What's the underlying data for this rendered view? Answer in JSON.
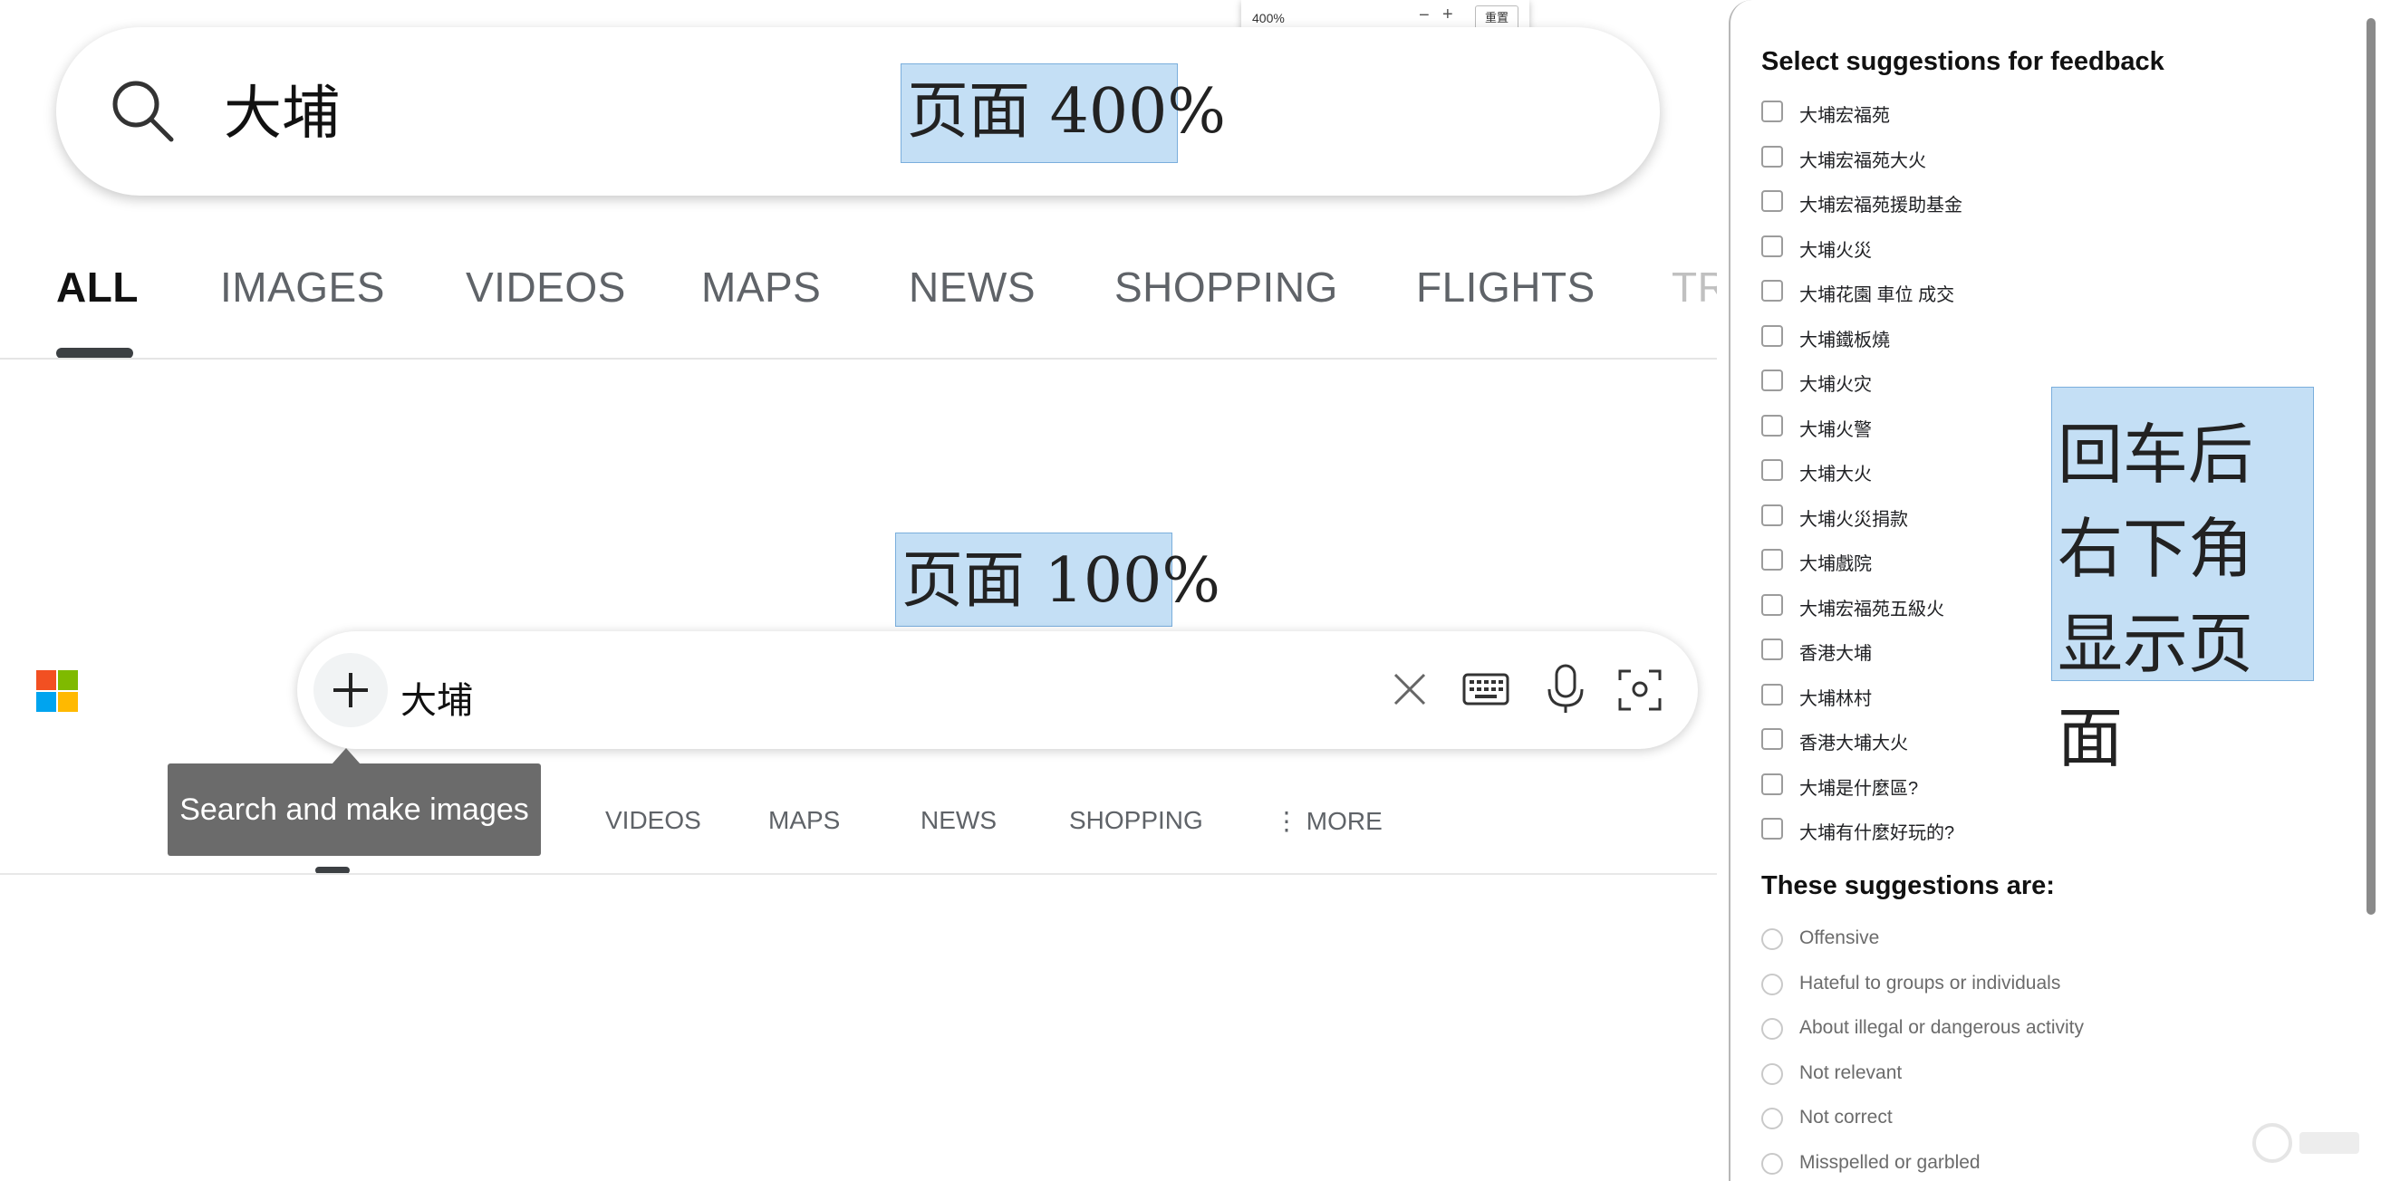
{
  "zoom_popup": {
    "zoom": "400%",
    "minus": "−",
    "plus": "+",
    "reset": "重置"
  },
  "big_view": {
    "query": "大埔",
    "tabs": [
      "ALL",
      "IMAGES",
      "VIDEOS",
      "MAPS",
      "NEWS",
      "SHOPPING",
      "FLIGHTS",
      "TR"
    ]
  },
  "notes": {
    "page400": "页面 400%",
    "page100": "页面 100%",
    "side_lines": [
      "回车后",
      "右下角",
      "显示页面"
    ]
  },
  "small_view": {
    "query": "大埔",
    "plus": "+",
    "tooltip": "Search and make images",
    "tabs": [
      "VIDEOS",
      "MAPS",
      "NEWS",
      "SHOPPING",
      "⋮ MORE"
    ]
  },
  "feedback_panel": {
    "title": "Select suggestions for feedback",
    "suggestions": [
      "大埔宏福苑",
      "大埔宏福苑大火",
      "大埔宏福苑援助基金",
      "大埔火災",
      "大埔花園 車位 成交",
      "大埔鐵板燒",
      "大埔火灾",
      "大埔火警",
      "大埔大火",
      "大埔火災捐款",
      "大埔戲院",
      "大埔宏福苑五級火",
      "香港大埔",
      "大埔林村",
      "香港大埔大火",
      "大埔是什麼區?",
      "大埔有什麼好玩的?"
    ],
    "reasons_title": "These suggestions are:",
    "reasons": [
      "Offensive",
      "Hateful to groups or individuals",
      "About illegal or dangerous activity",
      "Not relevant",
      "Not correct",
      "Misspelled or garbled"
    ]
  },
  "colors": {
    "note_fill": "#c4dff5",
    "ms_red": "#f25022",
    "ms_green": "#7fba00",
    "ms_blue": "#00a4ef",
    "ms_yellow": "#ffb900"
  }
}
